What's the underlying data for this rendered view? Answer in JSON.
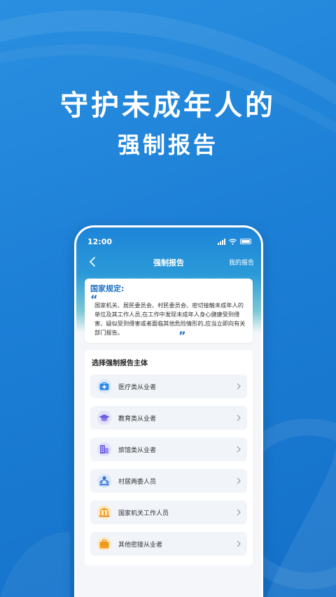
{
  "headline": {
    "line1": "守护未成年人的",
    "line2": "强制报告"
  },
  "status_bar": {
    "time": "12:00"
  },
  "nav": {
    "title": "强制报告",
    "right_link": "我的报告"
  },
  "notice": {
    "title": "国家规定:",
    "open_quote": "“",
    "text": "国家机关、居民委员会、村民委员会、密切接触未成年人的单位及其工作人员,在工作中发现未成年人身心健康受到侵害、疑似受到侵害或者面临其他危险情形的,应当立即向有关部门报告。",
    "close_quote": "”"
  },
  "panel": {
    "title": "选择强制报告主体",
    "items": [
      {
        "label": "医疗类从业者",
        "icon": "medical-kit-icon"
      },
      {
        "label": "教育类从业者",
        "icon": "graduation-cap-icon"
      },
      {
        "label": "旅馆类从业者",
        "icon": "hotel-building-icon"
      },
      {
        "label": "村居两委人员",
        "icon": "people-group-icon"
      },
      {
        "label": "国家机关工作人员",
        "icon": "government-building-icon"
      },
      {
        "label": "其他密接从业者",
        "icon": "briefcase-icon"
      }
    ]
  },
  "colors": {
    "primary": "#1d6fc4",
    "background": "#1c7fd6"
  }
}
